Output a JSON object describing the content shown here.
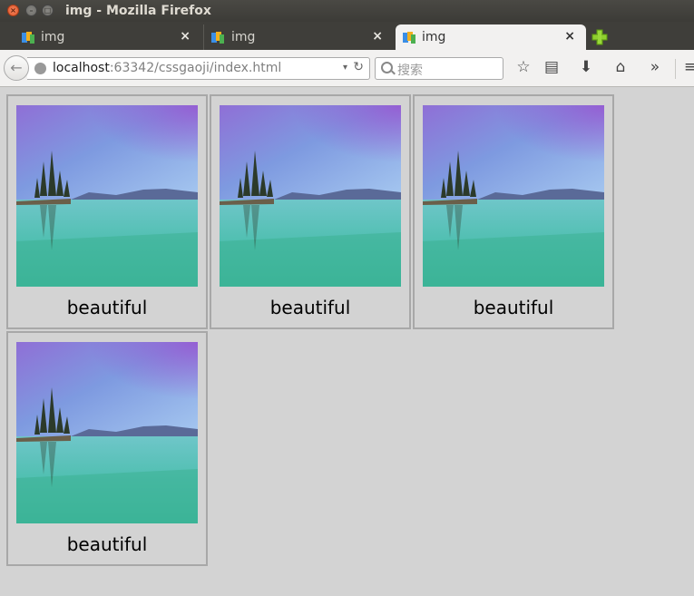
{
  "window": {
    "title": "img - Mozilla Firefox"
  },
  "tabs": [
    {
      "label": "img",
      "close": "×"
    },
    {
      "label": "img",
      "close": "×"
    },
    {
      "label": "img",
      "close": "×"
    }
  ],
  "navbar": {
    "back_icon": "←",
    "url_host": "localhost",
    "url_rest": ":63342/cssgaoji/index.html",
    "dropdown_icon": "▾",
    "reload_icon": "↻",
    "search_placeholder": "搜索",
    "bookmark_icon": "☆",
    "reading_list_icon": "▤",
    "download_icon": "⬇",
    "home_icon": "⌂",
    "overflow_icon": "»",
    "menu_icon": "≡"
  },
  "gallery": {
    "items": [
      {
        "caption": "beautiful"
      },
      {
        "caption": "beautiful"
      },
      {
        "caption": "beautiful"
      },
      {
        "caption": "beautiful"
      }
    ]
  },
  "colors": {
    "page_background": "#d3d3d3",
    "card_border": "#a8a8a8",
    "titlebar": "#3c3b37",
    "active_tab": "#f2f1f0"
  }
}
